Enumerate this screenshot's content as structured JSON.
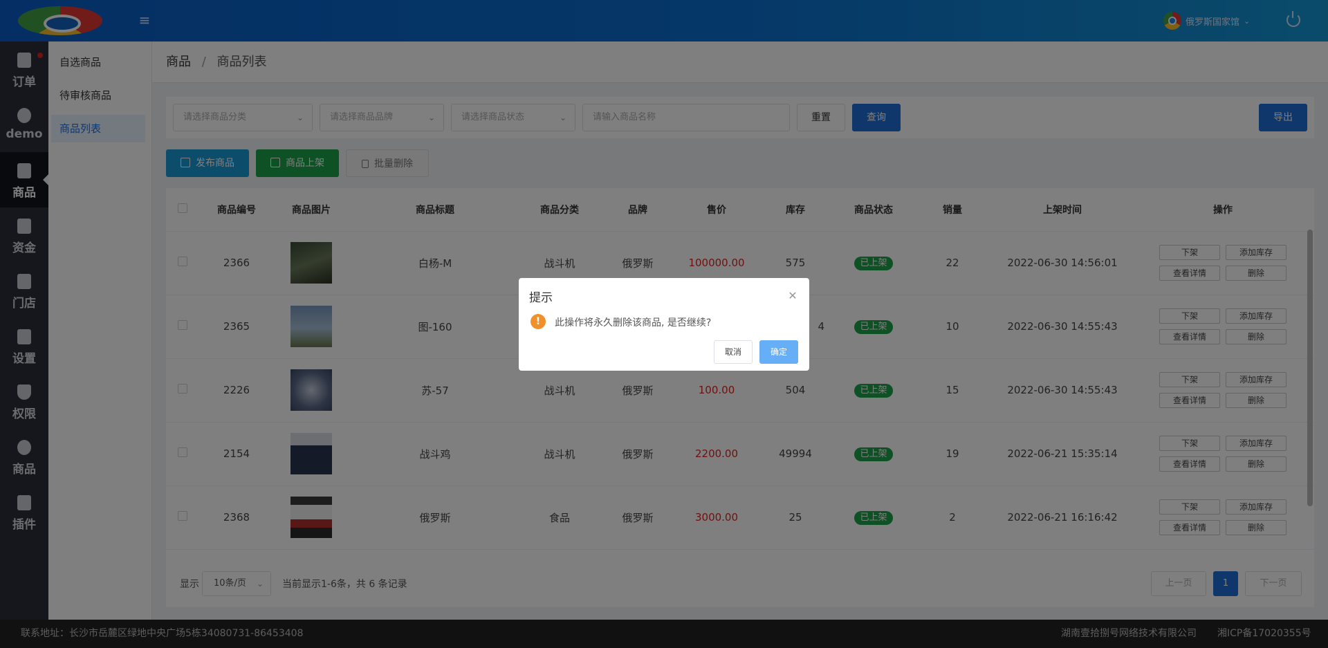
{
  "header": {
    "user_name": "俄罗斯国家馆"
  },
  "leftnav": {
    "items": [
      {
        "label": "订单",
        "icon": "clipboard-icon"
      },
      {
        "label": "demo",
        "icon": "pie-chart-icon"
      },
      {
        "label": "商品",
        "icon": "shopping-bag-icon"
      },
      {
        "label": "资金",
        "icon": "wallet-icon"
      },
      {
        "label": "门店",
        "icon": "store-icon"
      },
      {
        "label": "设置",
        "icon": "puzzle-icon"
      },
      {
        "label": "权限",
        "icon": "shield-icon"
      },
      {
        "label": "商品",
        "icon": "pie-chart-icon"
      },
      {
        "label": "插件",
        "icon": "puzzle-icon"
      }
    ],
    "active_index": 2
  },
  "subnav": {
    "items": [
      "自选商品",
      "待审核商品",
      "商品列表"
    ],
    "active_index": 2
  },
  "breadcrumb": {
    "parent": "商品",
    "separator": "/",
    "current": "商品列表"
  },
  "filters": {
    "category_placeholder": "请选择商品分类",
    "brand_placeholder": "请选择商品品牌",
    "status_placeholder": "请选择商品状态",
    "name_placeholder": "请输入商品名称",
    "reset_label": "重置",
    "search_label": "查询",
    "export_label": "导出"
  },
  "actions": {
    "publish_label": "发布商品",
    "onshelf_label": "商品上架",
    "batch_delete_label": "批量删除"
  },
  "table": {
    "columns": [
      "商品编号",
      "商品图片",
      "商品标题",
      "商品分类",
      "品牌",
      "售价",
      "库存",
      "商品状态",
      "销量",
      "上架时间",
      "操作"
    ],
    "op_labels": {
      "offshelf": "下架",
      "add_stock": "添加库存",
      "view_detail": "查看详情",
      "delete": "删除"
    },
    "rows": [
      {
        "id": "2366",
        "title": "白杨-M",
        "category": "战斗机",
        "brand": "俄罗斯",
        "price": "100000.00",
        "stock": "575",
        "status": "已上架",
        "sales": "22",
        "time": "2022-06-30 14:56:01"
      },
      {
        "id": "2365",
        "title": "图-160",
        "category": "",
        "brand": "",
        "price": "",
        "stock": "4",
        "status": "已上架",
        "sales": "10",
        "time": "2022-06-30 14:55:43"
      },
      {
        "id": "2226",
        "title": "苏-57",
        "category": "战斗机",
        "brand": "俄罗斯",
        "price": "100.00",
        "stock": "504",
        "status": "已上架",
        "sales": "15",
        "time": "2022-06-30 14:55:43"
      },
      {
        "id": "2154",
        "title": "战斗鸡",
        "category": "战斗机",
        "brand": "俄罗斯",
        "price": "2200.00",
        "stock": "49994",
        "status": "已上架",
        "sales": "19",
        "time": "2022-06-21 15:35:14"
      },
      {
        "id": "2368",
        "title": "俄罗斯",
        "category": "食品",
        "brand": "俄罗斯",
        "price": "3000.00",
        "stock": "25",
        "status": "已上架",
        "sales": "2",
        "time": "2022-06-21 16:16:42"
      }
    ]
  },
  "pagination": {
    "show_label": "显示",
    "page_size": "10条/页",
    "summary": "当前显示1-6条，共 6 条记录",
    "prev_label": "上一页",
    "current_page": "1",
    "next_label": "下一页"
  },
  "footer": {
    "address": "联系地址：长沙市岳麓区绿地中央广场5栋34080731-86453408",
    "company": "湖南壹拾捌号网络技术有限公司",
    "icp": "湘ICP备17020355号"
  },
  "dialog": {
    "title": "提示",
    "message": "此操作将永久删除该商品, 是否继续?",
    "cancel_label": "取消",
    "confirm_label": "确定"
  },
  "colors": {
    "header_blue": "#0a5ec8",
    "primary": "#1e6fd9",
    "success": "#1aa34a",
    "info": "#1a9ad9",
    "price_red": "#e02020",
    "warning": "#f0902a"
  }
}
